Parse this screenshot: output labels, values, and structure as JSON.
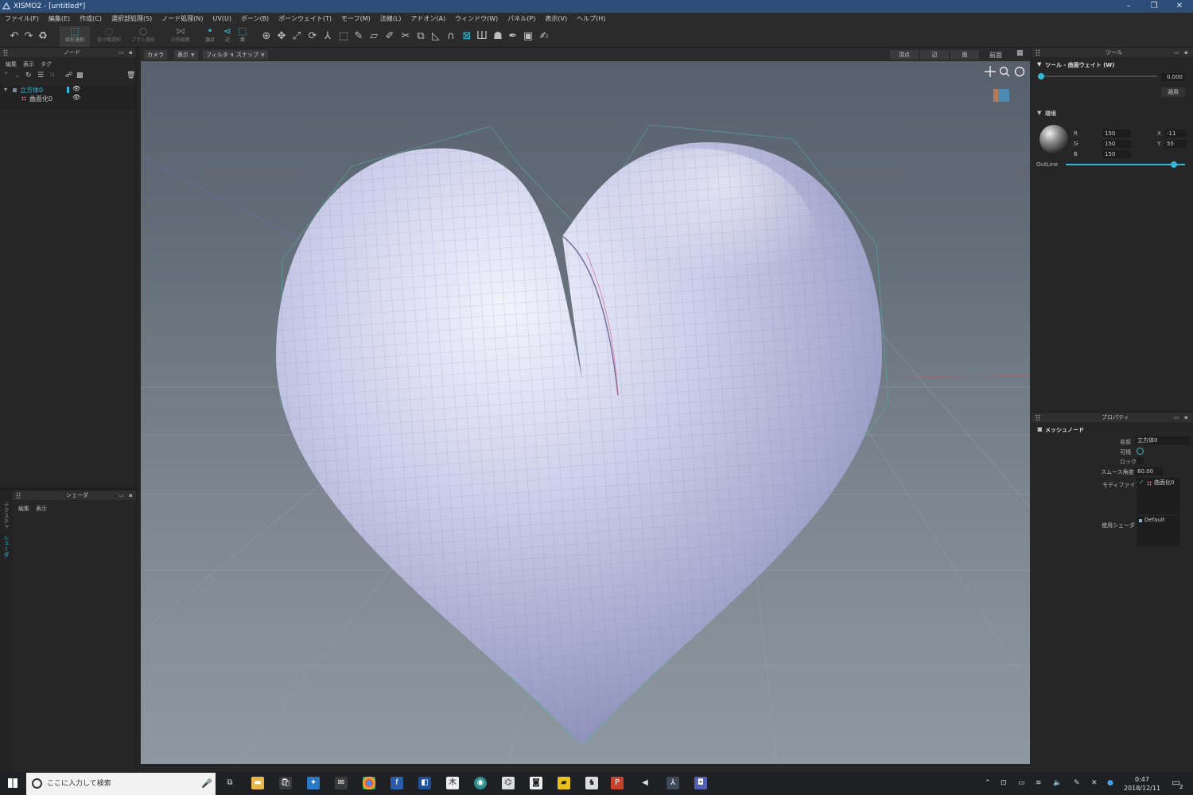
{
  "window": {
    "title": "XISMO2 - [untitled*]",
    "controls": [
      "–",
      "❐",
      "✕"
    ]
  },
  "menu": [
    "ファイル(F)",
    "編集(E)",
    "作成(C)",
    "選択部処理(S)",
    "ノード処理(N)",
    "UV(U)",
    "ボーン(B)",
    "ボーンウェイト(T)",
    "モーフ(M)",
    "法線(L)",
    "アドオン(A)",
    "ウィンドウ(W)",
    "パネル(P)",
    "表示(V)",
    "ヘルプ(H)"
  ],
  "toolbar": {
    "select_rect": "矩形選択",
    "select_lasso": "投げ縄選択",
    "select_brush": "ブラシ選択",
    "symmetry": "対称編集",
    "vertex": "頂点",
    "edge": "辺",
    "face": "面"
  },
  "node_panel": {
    "title": "ノード",
    "menu": [
      "編集",
      "表示",
      "タグ"
    ],
    "tree": [
      {
        "label": "立方体0",
        "level": 0,
        "selected": true
      },
      {
        "label": "曲面化0",
        "level": 1,
        "selected": false
      }
    ]
  },
  "shader_panel": {
    "title": "シェーダ",
    "menu": [
      "編集",
      "表示"
    ],
    "side_tabs": [
      "テクスチャ",
      "シェーダ"
    ]
  },
  "viewport": {
    "buttons": {
      "camera": "カメラ",
      "display": "表示",
      "filter": "フィルタ",
      "snap": "スナップ"
    },
    "modes": [
      "頂点",
      "辺",
      "面"
    ],
    "view_name": "前面"
  },
  "tool_panel": {
    "title": "ツール",
    "section": "ツール - 曲面ウェイト (W)",
    "weight": "0.000",
    "weight_fraction": 0.0,
    "apply": "適用",
    "env_section": "環境",
    "r_label": "R",
    "r": "150",
    "g_label": "G",
    "g": "150",
    "b_label": "B",
    "b": "150",
    "x_label": "X",
    "x": "-11",
    "y_label": "Y",
    "y": "55",
    "outline_label": "OutLine",
    "outline_fraction": 0.93
  },
  "property_panel": {
    "title": "プロパティ",
    "section": "メッシュノード",
    "name_label": "名前",
    "name": "立方体0",
    "visible_label": "可視",
    "lock_label": "ロック",
    "smooth_label": "スムース角度",
    "smooth": "60.00",
    "modifier_label": "モディファイア",
    "modifier": "曲面化0",
    "shader_label": "使用シェーダ",
    "shader": "Default"
  },
  "taskbar": {
    "search_placeholder": "ここに入力して検索",
    "time": "0:47",
    "date": "2018/12/11",
    "notifications": "2"
  },
  "colors": {
    "accent": "#35b8d8",
    "titlebar": "#2c4d78",
    "mesh": "#a9acd4"
  }
}
